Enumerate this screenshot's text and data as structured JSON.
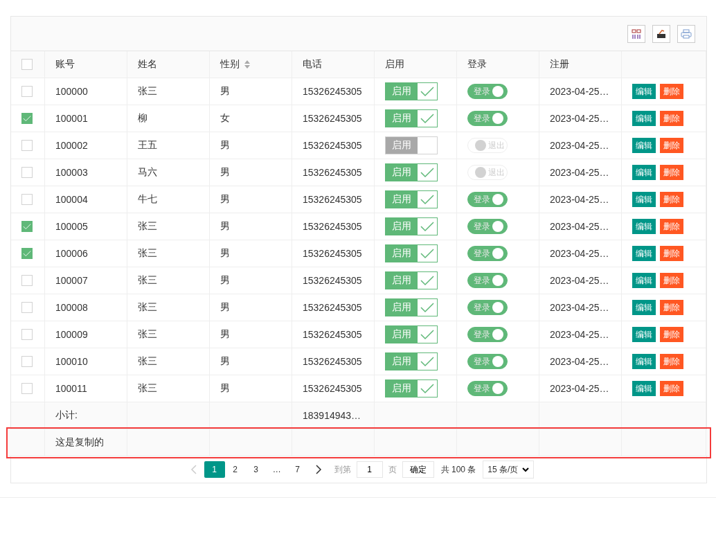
{
  "toolbar": {
    "tools": [
      {
        "kind": "columns"
      },
      {
        "kind": "export"
      },
      {
        "kind": "print"
      }
    ]
  },
  "table": {
    "columns": [
      {
        "label": "账号",
        "sortable": false
      },
      {
        "label": "姓名",
        "sortable": false
      },
      {
        "label": "性别",
        "sortable": true
      },
      {
        "label": "电话",
        "sortable": false
      },
      {
        "label": "启用",
        "sortable": false
      },
      {
        "label": "登录",
        "sortable": false
      },
      {
        "label": "注册",
        "sortable": false
      }
    ],
    "all_checked": false,
    "rows": [
      {
        "checked": false,
        "account": "100000",
        "name": "张三",
        "gender": "男",
        "phone": "15326245305",
        "enabled": true,
        "enabled_label": "启用",
        "login": true,
        "login_label": "登录",
        "registered": "2023-04-25…",
        "edit": "编辑",
        "delete": "删除"
      },
      {
        "checked": true,
        "account": "100001",
        "name": "柳",
        "gender": "女",
        "phone": "15326245305",
        "enabled": true,
        "enabled_label": "启用",
        "login": true,
        "login_label": "登录",
        "registered": "2023-04-25…",
        "edit": "编辑",
        "delete": "删除"
      },
      {
        "checked": false,
        "account": "100002",
        "name": "王五",
        "gender": "男",
        "phone": "15326245305",
        "enabled": false,
        "enabled_label": "启用",
        "login": false,
        "login_label": "退出",
        "registered": "2023-04-25…",
        "edit": "编辑",
        "delete": "删除"
      },
      {
        "checked": false,
        "account": "100003",
        "name": "马六",
        "gender": "男",
        "phone": "15326245305",
        "enabled": true,
        "enabled_label": "启用",
        "login": false,
        "login_label": "退出",
        "registered": "2023-04-25…",
        "edit": "编辑",
        "delete": "删除"
      },
      {
        "checked": false,
        "account": "100004",
        "name": "牛七",
        "gender": "男",
        "phone": "15326245305",
        "enabled": true,
        "enabled_label": "启用",
        "login": true,
        "login_label": "登录",
        "registered": "2023-04-25…",
        "edit": "编辑",
        "delete": "删除"
      },
      {
        "checked": true,
        "account": "100005",
        "name": "张三",
        "gender": "男",
        "phone": "15326245305",
        "enabled": true,
        "enabled_label": "启用",
        "login": true,
        "login_label": "登录",
        "registered": "2023-04-25…",
        "edit": "编辑",
        "delete": "删除"
      },
      {
        "checked": true,
        "account": "100006",
        "name": "张三",
        "gender": "男",
        "phone": "15326245305",
        "enabled": true,
        "enabled_label": "启用",
        "login": true,
        "login_label": "登录",
        "registered": "2023-04-25…",
        "edit": "编辑",
        "delete": "删除"
      },
      {
        "checked": false,
        "account": "100007",
        "name": "张三",
        "gender": "男",
        "phone": "15326245305",
        "enabled": true,
        "enabled_label": "启用",
        "login": true,
        "login_label": "登录",
        "registered": "2023-04-25…",
        "edit": "编辑",
        "delete": "删除"
      },
      {
        "checked": false,
        "account": "100008",
        "name": "张三",
        "gender": "男",
        "phone": "15326245305",
        "enabled": true,
        "enabled_label": "启用",
        "login": true,
        "login_label": "登录",
        "registered": "2023-04-25…",
        "edit": "编辑",
        "delete": "删除"
      },
      {
        "checked": false,
        "account": "100009",
        "name": "张三",
        "gender": "男",
        "phone": "15326245305",
        "enabled": true,
        "enabled_label": "启用",
        "login": true,
        "login_label": "登录",
        "registered": "2023-04-25…",
        "edit": "编辑",
        "delete": "删除"
      },
      {
        "checked": false,
        "account": "100010",
        "name": "张三",
        "gender": "男",
        "phone": "15326245305",
        "enabled": true,
        "enabled_label": "启用",
        "login": true,
        "login_label": "登录",
        "registered": "2023-04-25…",
        "edit": "编辑",
        "delete": "删除"
      },
      {
        "checked": false,
        "account": "100011",
        "name": "张三",
        "gender": "男",
        "phone": "15326245305",
        "enabled": true,
        "enabled_label": "启用",
        "login": true,
        "login_label": "登录",
        "registered": "2023-04-25…",
        "edit": "编辑",
        "delete": "删除"
      }
    ],
    "totals": [
      {
        "label": "小计:",
        "phone": "183914943…",
        "highlighted": false
      },
      {
        "label": "这是复制的",
        "highlighted": true
      }
    ]
  },
  "pagination": {
    "pages": [
      {
        "label": "1",
        "selected": true
      },
      {
        "label": "2",
        "selected": false
      },
      {
        "label": "3",
        "selected": false
      },
      {
        "label": "…",
        "selected": false
      },
      {
        "label": "7",
        "selected": false
      }
    ],
    "goto_label": "到第",
    "goto_value": "1",
    "page_unit": "页",
    "confirm": "确定",
    "total": "共 100 条",
    "page_size": "15 条/页"
  }
}
